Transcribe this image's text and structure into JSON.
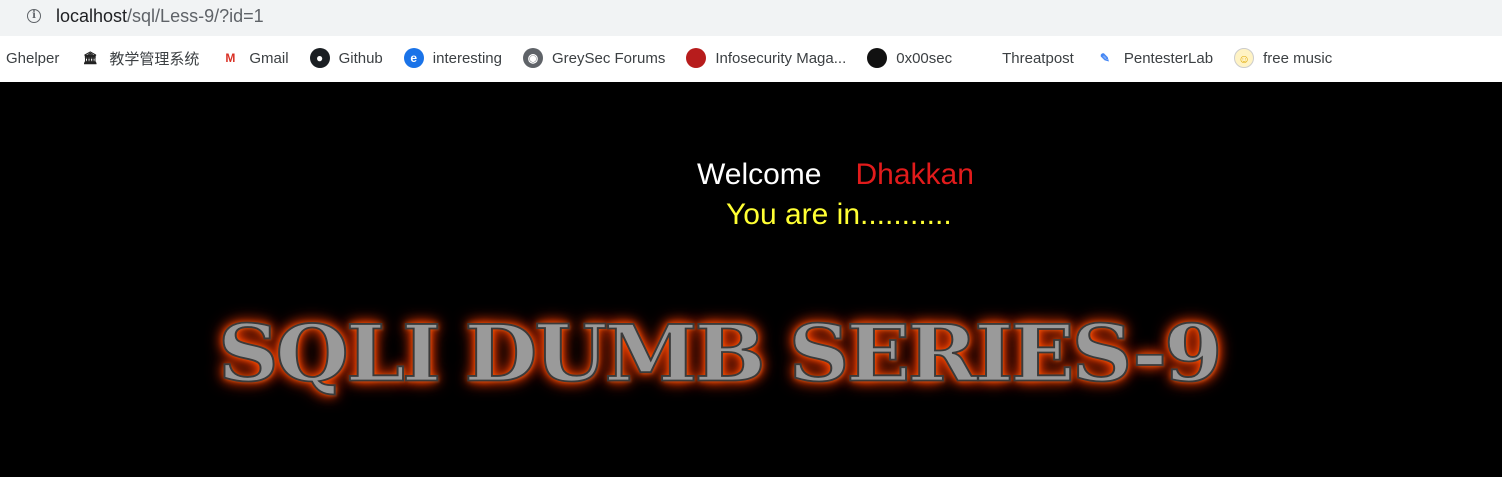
{
  "browser": {
    "url_host": "localhost",
    "url_path": "/sql/Less-9/?id=1",
    "bookmarks": [
      {
        "label": "Ghelper",
        "icon": "none"
      },
      {
        "label": "教学管理系统",
        "icon": "bank-icon"
      },
      {
        "label": "Gmail",
        "icon": "gmail-icon"
      },
      {
        "label": "Github",
        "icon": "github-icon"
      },
      {
        "label": "interesting",
        "icon": "edge-icon"
      },
      {
        "label": "GreySec Forums",
        "icon": "globe-icon"
      },
      {
        "label": "Infosecurity Maga...",
        "icon": "is-icon"
      },
      {
        "label": "0x00sec",
        "icon": "0x00sec-icon"
      },
      {
        "label": "Threatpost",
        "icon": "tp-icon"
      },
      {
        "label": "PentesterLab",
        "icon": "pen-icon"
      },
      {
        "label": "free music",
        "icon": "duck-icon"
      }
    ]
  },
  "page": {
    "welcome": "Welcome",
    "name": "Dhakkan",
    "status": "You are in...........",
    "banner": "SQLI DUMB SERIES-9"
  },
  "colors": {
    "background": "#000000",
    "welcome": "#ffffff",
    "name": "#e11b1b",
    "status": "#ffff33",
    "banner_glow": "#ff4500"
  }
}
